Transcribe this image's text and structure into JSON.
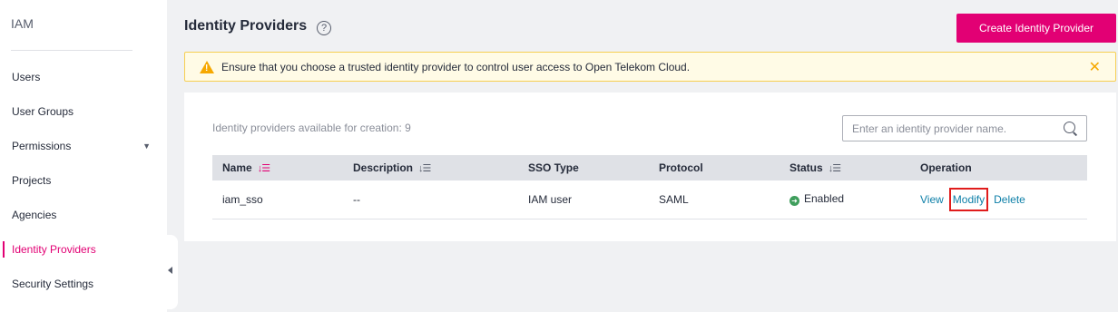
{
  "sidebar": {
    "title": "IAM",
    "items": [
      {
        "label": "Users"
      },
      {
        "label": "User Groups"
      },
      {
        "label": "Permissions"
      },
      {
        "label": "Projects"
      },
      {
        "label": "Agencies"
      },
      {
        "label": "Identity Providers"
      },
      {
        "label": "Security Settings"
      }
    ],
    "active_item": "Identity Providers"
  },
  "header": {
    "title": "Identity Providers",
    "help_icon": "?",
    "create_button": "Create Identity Provider"
  },
  "alert": {
    "text": "Ensure that you choose a trusted identity provider to control user access to Open Telekom Cloud.",
    "warning_icon": "!",
    "close_icon": "✕"
  },
  "main": {
    "quota_text": "Identity providers available for creation: 9",
    "search": {
      "placeholder": "Enter an identity provider name.",
      "value": ""
    },
    "table": {
      "columns": [
        {
          "label": "Name",
          "sort_icon": "↓☰"
        },
        {
          "label": "Description",
          "sort_icon": "↓☰"
        },
        {
          "label": "SSO Type"
        },
        {
          "label": "Protocol"
        },
        {
          "label": "Status",
          "sort_icon": "↓☰"
        },
        {
          "label": "Operation"
        }
      ],
      "rows": [
        {
          "name": "iam_sso",
          "description": "--",
          "sso_type": "IAM user",
          "protocol": "SAML",
          "status": "Enabled",
          "status_icon": "➜",
          "operations": [
            "View",
            "Modify",
            "Delete"
          ]
        }
      ]
    }
  },
  "colors": {
    "accent": "#e20074",
    "link": "#0d7fa8",
    "status_enabled": "#3f9e5c",
    "highlight_box": "#e01c1c"
  }
}
